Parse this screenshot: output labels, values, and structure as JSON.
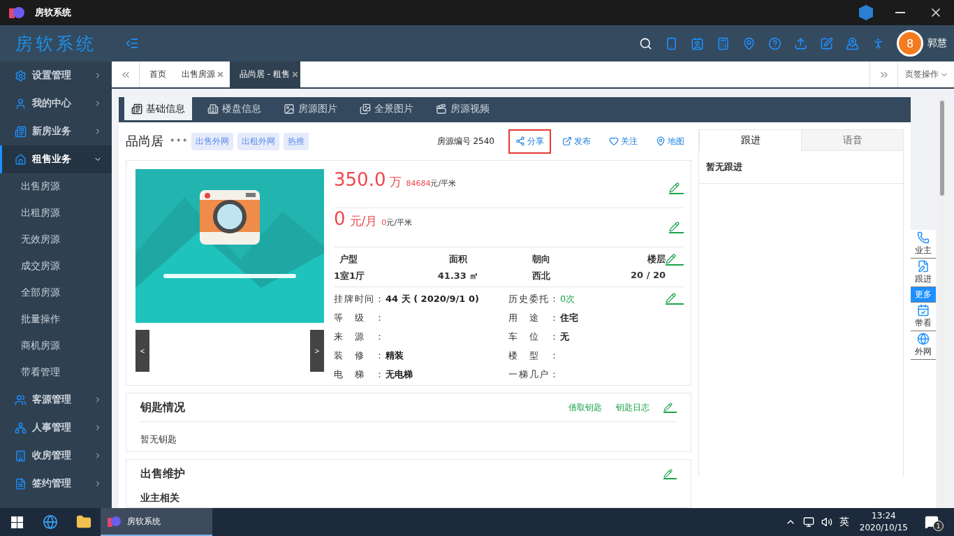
{
  "window": {
    "title": "房软系统"
  },
  "header": {
    "logo": "房软系统",
    "avatar_badge": "8",
    "user": "郭慧"
  },
  "sidebar": {
    "items": [
      {
        "label": "设置管理",
        "selected": false,
        "expanded": false
      },
      {
        "label": "我的中心",
        "selected": false,
        "expanded": false
      },
      {
        "label": "新房业务",
        "selected": false,
        "expanded": false
      },
      {
        "label": "租售业务",
        "selected": true,
        "expanded": true,
        "children": [
          {
            "label": "出售房源"
          },
          {
            "label": "出租房源"
          },
          {
            "label": "无效房源"
          },
          {
            "label": "成交房源"
          },
          {
            "label": "全部房源"
          },
          {
            "label": "批量操作"
          },
          {
            "label": "商机房源"
          },
          {
            "label": "带看管理"
          }
        ]
      },
      {
        "label": "客源管理",
        "selected": false,
        "expanded": false
      },
      {
        "label": "人事管理",
        "selected": false,
        "expanded": false
      },
      {
        "label": "收房管理",
        "selected": false,
        "expanded": false
      },
      {
        "label": "签约管理",
        "selected": false,
        "expanded": false
      }
    ]
  },
  "page_tabs": {
    "items": [
      {
        "label": "首页",
        "selected": false,
        "closable": false
      },
      {
        "label": "出售房源",
        "selected": false,
        "closable": true
      },
      {
        "label": "品尚居 - 租售",
        "selected": true,
        "closable": true
      }
    ],
    "menu": "页签操作"
  },
  "detail_tabs": [
    {
      "label": "基础信息",
      "selected": true
    },
    {
      "label": "楼盘信息",
      "selected": false
    },
    {
      "label": "房源图片",
      "selected": false
    },
    {
      "label": "全景图片",
      "selected": false
    },
    {
      "label": "房源视频",
      "selected": false
    }
  ],
  "property": {
    "name": "品尚居",
    "stars": "* * *",
    "tags": [
      "出售外网",
      "出租外网",
      "热推"
    ],
    "code": "房源编号 2540",
    "actions": [
      {
        "label": "分享",
        "highlighted": true
      },
      {
        "label": "发布",
        "highlighted": false
      },
      {
        "label": "关注",
        "highlighted": false
      },
      {
        "label": "地图",
        "highlighted": false
      }
    ]
  },
  "gallery": {
    "prev": "<",
    "next": ">"
  },
  "prices": [
    {
      "value": "350.0",
      "unit": "万",
      "per_value": "84684",
      "per_unit": "元/平米"
    },
    {
      "value": "0",
      "unit": "元/月",
      "per_value": "0",
      "per_unit": "元/平米"
    }
  ],
  "specs": [
    {
      "label": "户型",
      "value": "1室1厅"
    },
    {
      "label": "面积",
      "value": "41.33 ㎡"
    },
    {
      "label": "朝向",
      "value": "西北"
    },
    {
      "label": "楼层",
      "value": "20 / 20"
    }
  ],
  "details": [
    {
      "kind": "text",
      "label": "挂牌时间：",
      "value": "44 天 ( 2020/9/1 0)"
    },
    {
      "kind": "count",
      "label": "历史委托：",
      "value": "0次"
    },
    {
      "label": "等级："
    },
    {
      "kind": "text",
      "label": "用途：",
      "value": "住宅"
    },
    {
      "label": "来源："
    },
    {
      "kind": "text",
      "label": "车位：",
      "value": "无"
    },
    {
      "kind": "text",
      "label": "装修：",
      "value": "精装"
    },
    {
      "label": "楼型："
    },
    {
      "kind": "text",
      "label": "电梯：",
      "value": "无电梯"
    },
    {
      "label": "一梯几户："
    }
  ],
  "keys": {
    "title": "钥匙情况",
    "links": [
      "借取钥匙",
      "钥匙日志"
    ],
    "text": "暂无钥匙"
  },
  "maintenance": {
    "title": "出售维护",
    "subtitle": "业主相关"
  },
  "follow_panel": {
    "tabs": [
      {
        "label": "跟进",
        "selected": true
      },
      {
        "label": "语音",
        "selected": false
      }
    ],
    "text": "暂无跟进"
  },
  "float_toolbar": [
    {
      "label": "业主",
      "selected": false
    },
    {
      "label": "跟进",
      "selected": false
    },
    {
      "label": "更多",
      "selected": true
    },
    {
      "label": "带看",
      "selected": false
    },
    {
      "label": "外网",
      "selected": false
    }
  ],
  "taskbar": {
    "app": "房软系统",
    "ime": "英",
    "time": "13:24",
    "date": "2020/10/15",
    "notifications": "1"
  }
}
